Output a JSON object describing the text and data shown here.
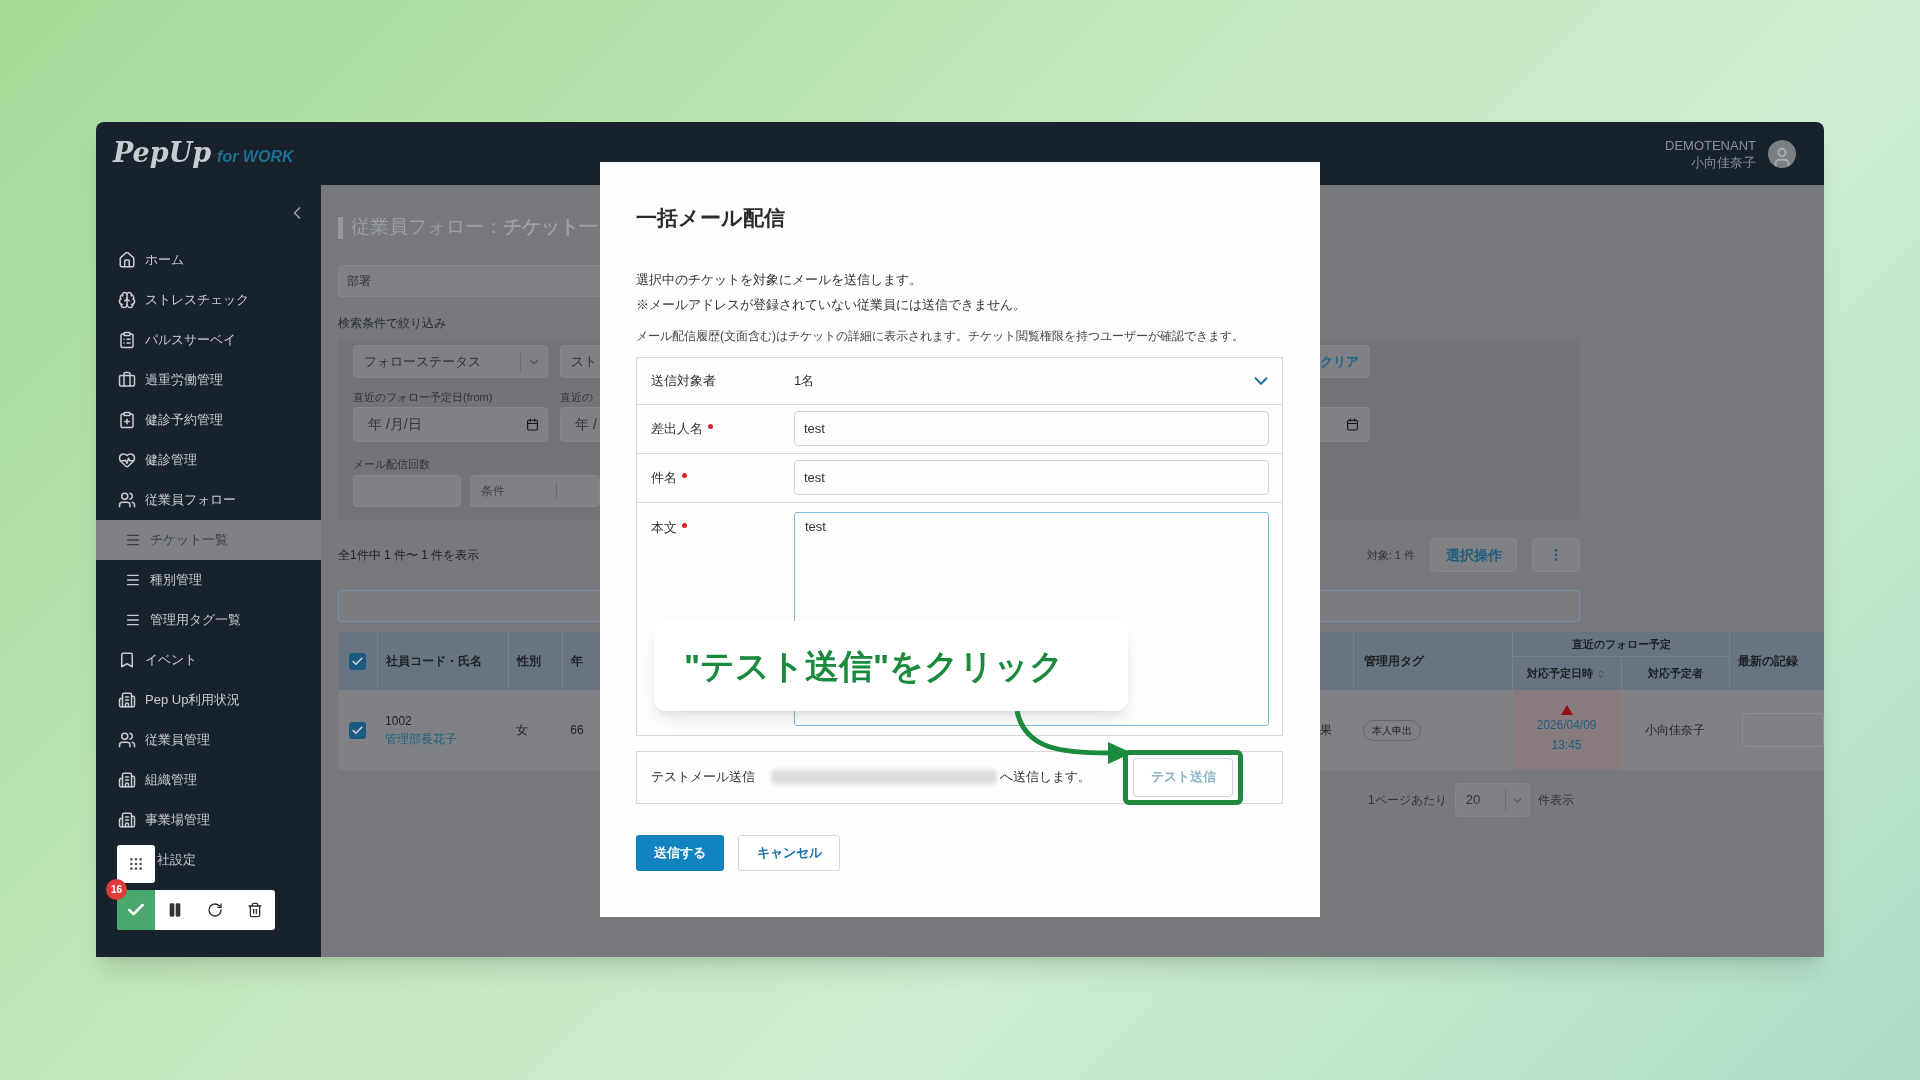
{
  "header": {
    "logo": "PepUp",
    "logo_suffix": "for WORK",
    "tenant": "DEMOTENANT",
    "user": "小向佳奈子"
  },
  "sidebar": {
    "items": [
      {
        "label": "ホーム",
        "selected": false
      },
      {
        "label": "ストレスチェック",
        "selected": false
      },
      {
        "label": "パルスサーベイ",
        "selected": false
      },
      {
        "label": "過重労働管理",
        "selected": false
      },
      {
        "label": "健診予約管理",
        "selected": false
      },
      {
        "label": "健診管理",
        "selected": false
      },
      {
        "label": "従業員フォロー",
        "selected": false,
        "children": [
          {
            "label": "チケット一覧",
            "selected": true
          },
          {
            "label": "種別管理",
            "selected": false
          },
          {
            "label": "管理用タグ一覧",
            "selected": false
          }
        ]
      },
      {
        "label": "イベント",
        "selected": false
      },
      {
        "label": "Pep Up利用状況",
        "selected": false
      },
      {
        "label": "従業員管理",
        "selected": false
      },
      {
        "label": "組織管理",
        "selected": false
      },
      {
        "label": "事業場管理",
        "selected": false
      },
      {
        "label": "社設定",
        "selected": false
      }
    ]
  },
  "page": {
    "title": "従業員フォロー：**チケット一**",
    "department_placeholder": "部署",
    "filter_label": "検索条件で絞り込み",
    "selects": [
      "フォローステータス",
      "スト"
    ],
    "date_labels": [
      "直近のフォロー予定日(from)",
      "直近の"
    ],
    "date_values": [
      "年 /月/日",
      "年 /"
    ],
    "mail_count_label": "メール配信回数",
    "condition_placeholder": "条件",
    "clear_button": "クリア",
    "result_count": "全1件中 1 件〜 1 件を表示",
    "target_count": "対象: 1 件",
    "bulk_button": "選択操作",
    "table": {
      "header_checked": true,
      "columns_left": [
        "社員コード・氏名",
        "性別",
        "年"
      ],
      "tag_column": "管理用タグ",
      "group_column": "直近のフォロー予定",
      "sub_columns": [
        "対応予定日時",
        "対応予定者"
      ],
      "last_column": "最新の記録",
      "rows": [
        {
          "checked": true,
          "code": "1002",
          "name": "管理部長花子",
          "gender": "女",
          "age": "66",
          "cut_text": "果",
          "tag": "本人申出",
          "overdue": true,
          "due_date": "2026/04/09",
          "due_time": "13:45",
          "assignee": "小向佳奈子"
        }
      ]
    },
    "per_page_label": "1ページあたり",
    "per_page": "20",
    "per_page_suffix": "件表示"
  },
  "modal": {
    "title": "一括メール配信",
    "description": [
      "選択中のチケットを対象にメールを送信します。",
      "※メールアドレスが登録されていない従業員には送信できません。"
    ],
    "note": "メール配信履歴(文面含む)はチケットの詳細に表示されます。チケット閲覧権限を持つユーザーが確認できます。",
    "recipients_label": "送信対象者",
    "recipients_value": "1名",
    "fields": [
      {
        "label": "差出人名",
        "required": true,
        "value": "test"
      },
      {
        "label": "件名",
        "required": true,
        "value": "test"
      }
    ],
    "body": {
      "label": "本文",
      "required": true,
      "value": "test"
    },
    "test_label": "テストメール送信",
    "test_suffix": "へ送信します。",
    "test_button": "テスト送信",
    "buttons": [
      {
        "kind": "primary",
        "label": "送信する"
      },
      {
        "kind": "secondary",
        "label": "キャンセル"
      }
    ]
  },
  "callout": {
    "text": "\"テスト送信\"をクリック"
  },
  "recorder": {
    "badge": "16"
  }
}
